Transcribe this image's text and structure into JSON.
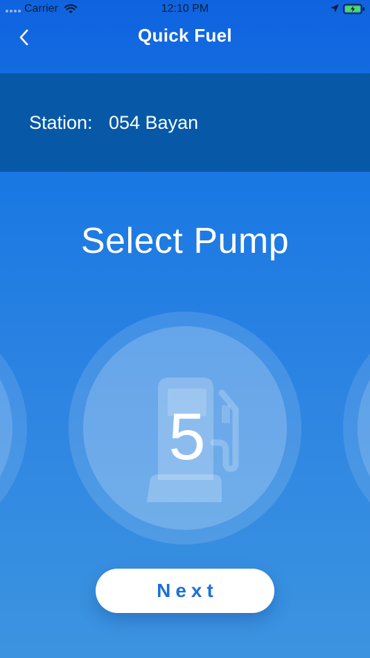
{
  "status_bar": {
    "carrier": "Carrier",
    "time": "12:10 PM",
    "icons": [
      "signal-dots-icon",
      "wifi-icon",
      "location-arrow-icon",
      "battery-charging-icon"
    ]
  },
  "nav": {
    "title": "Quick Fuel",
    "back_icon": "chevron-left-icon"
  },
  "station": {
    "label": "Station:",
    "value": "054 Bayan"
  },
  "heading": "Select Pump",
  "pump": {
    "selected_number": "5",
    "icon": "fuel-pump-icon"
  },
  "actions": {
    "next_label": "Next"
  },
  "colors": {
    "primary_blue": "#1a78e3",
    "station_band": "#0759a8",
    "button_text": "#1d6fd8"
  }
}
